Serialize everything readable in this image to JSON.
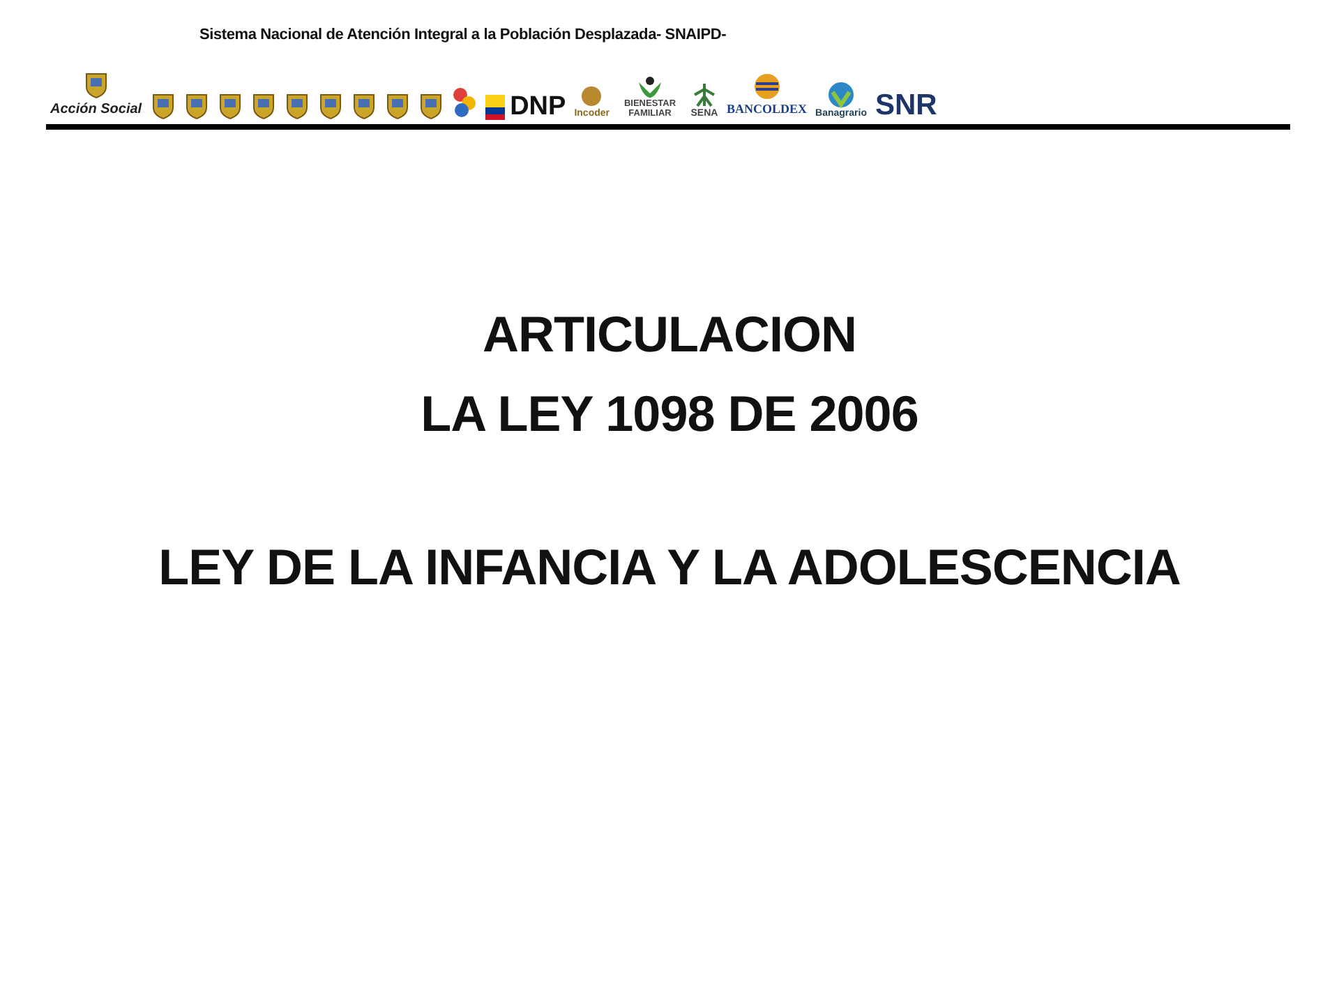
{
  "header": {
    "text": "Sistema Nacional de Atención Integral a la Población Desplazada- SNAIPD-"
  },
  "logos": [
    {
      "kind": "crest-wordmark",
      "text": "Acción Social"
    },
    {
      "kind": "crest"
    },
    {
      "kind": "crest"
    },
    {
      "kind": "crest"
    },
    {
      "kind": "crest"
    },
    {
      "kind": "crest"
    },
    {
      "kind": "crest"
    },
    {
      "kind": "crest"
    },
    {
      "kind": "crest"
    },
    {
      "kind": "crest"
    },
    {
      "kind": "swirl"
    },
    {
      "kind": "flag-wordmark",
      "text": "DNP"
    },
    {
      "kind": "seal-wordmark",
      "text": "Incoder"
    },
    {
      "kind": "hands-wordmark",
      "text": "BIENESTAR FAMILIAR"
    },
    {
      "kind": "figure-wordmark",
      "text": "SENA"
    },
    {
      "kind": "globe-wordmark",
      "text": "BANCOLDEX"
    },
    {
      "kind": "leaf-wordmark",
      "text": "Banagrario"
    },
    {
      "kind": "wordmark",
      "text": "SNR"
    }
  ],
  "title": {
    "lines": [
      "ARTICULACION",
      "LA LEY 1098 DE 2006"
    ],
    "subtitle": "LEY DE LA INFANCIA Y LA ADOLESCENCIA"
  }
}
